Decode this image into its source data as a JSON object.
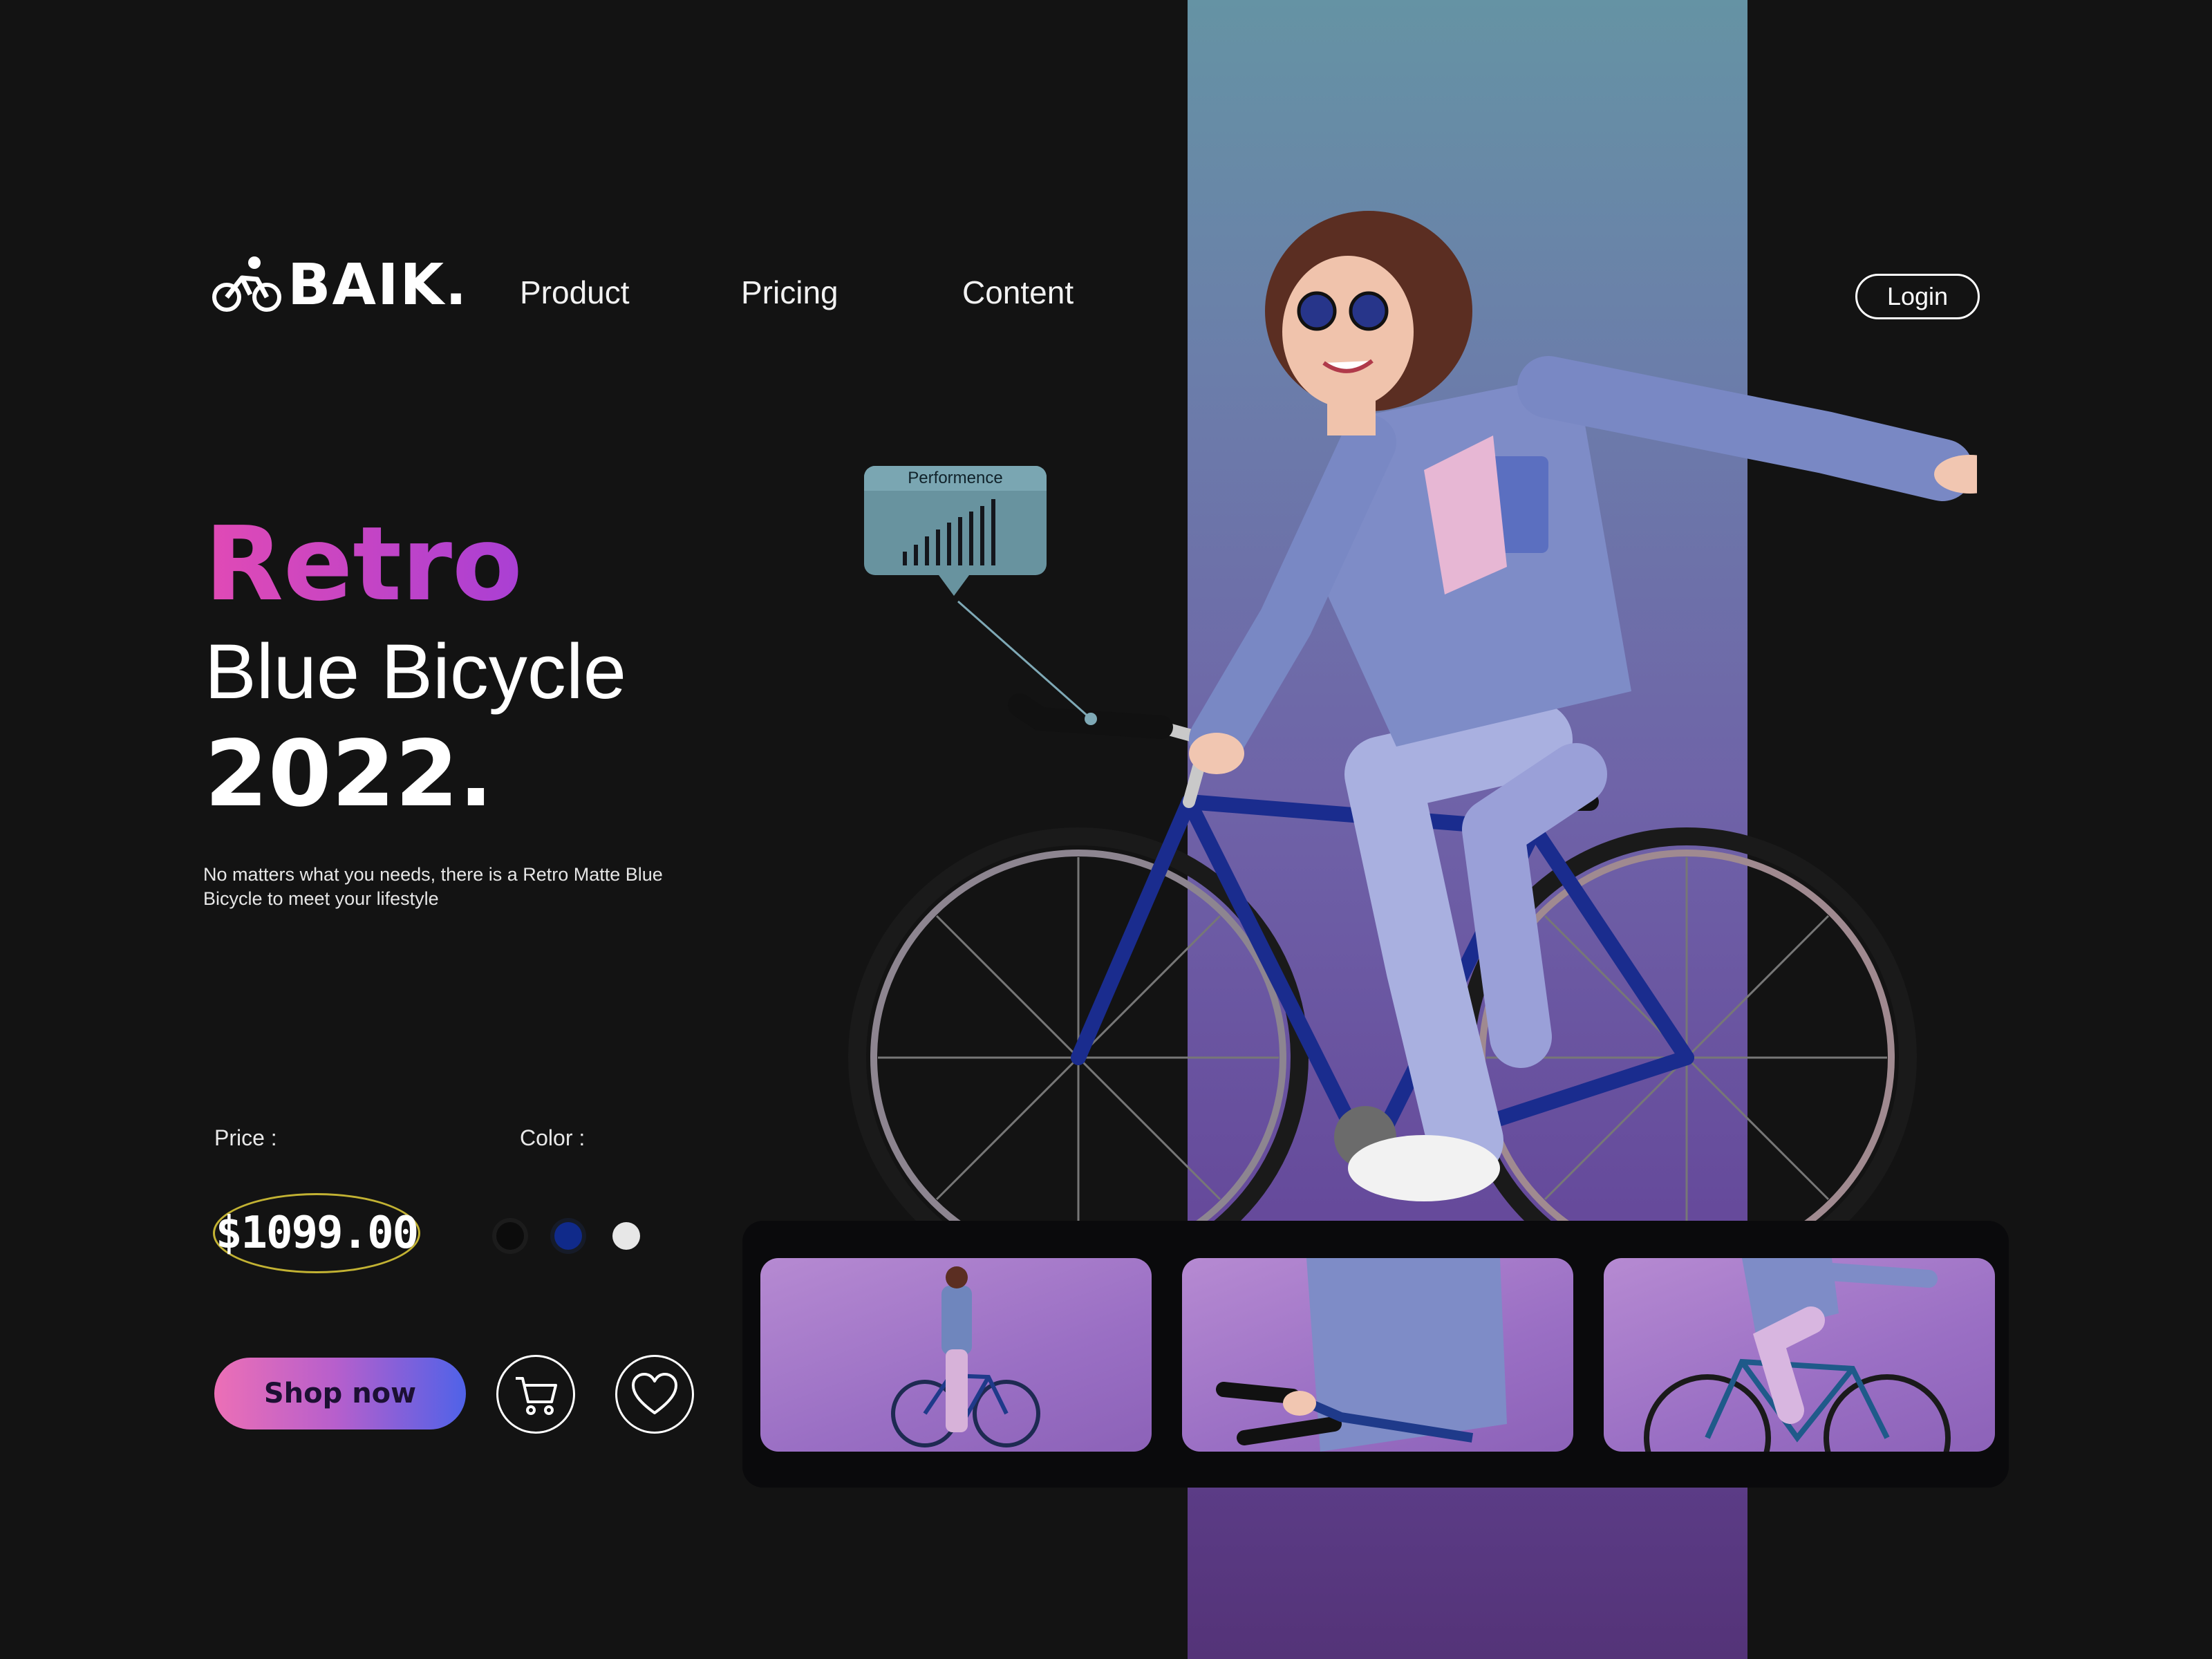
{
  "brand": {
    "name": "BAIK.",
    "icon": "cyclist-icon"
  },
  "nav": {
    "items": [
      "Product",
      "Pricing",
      "Content"
    ],
    "login": "Login"
  },
  "hero": {
    "title_accent": "Retro",
    "title_main": "Blue Bicycle",
    "title_year": "2022.",
    "description": "No matters what you needs, there is a Retro Matte Blue Bicycle to meet your lifestyle"
  },
  "product": {
    "price_label": "Price :",
    "price": "$1099.00",
    "color_label": "Color :",
    "colors": [
      {
        "name": "black",
        "hex": "#0c0c0c"
      },
      {
        "name": "blue",
        "hex": "#102a8a"
      },
      {
        "name": "white",
        "hex": "#e7e7e7"
      }
    ]
  },
  "actions": {
    "shop_now": "Shop now",
    "cart_icon": "cart-icon",
    "wishlist_icon": "heart-icon"
  },
  "performance": {
    "label": "Performence",
    "icon": "signal-bars-icon"
  },
  "colors": {
    "background": "#131313",
    "accent_gradient_start": "#e14ab5",
    "accent_gradient_end": "#a93fd4",
    "button_gradient": [
      "#ec6fb6",
      "#4f62e8"
    ],
    "price_ring": "#c2b233"
  }
}
